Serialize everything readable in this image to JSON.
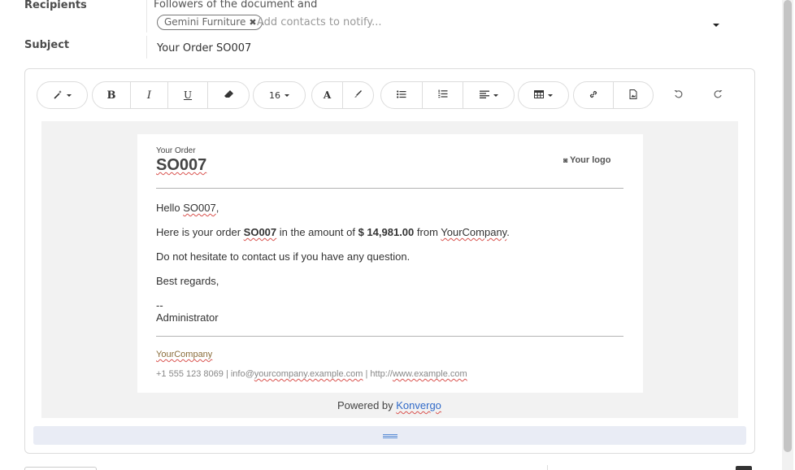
{
  "recipients": {
    "label": "Recipients",
    "followers_text": "Followers of the document and",
    "tag_label": "Gemini Furniture",
    "placeholder": "Add contacts to notify..."
  },
  "subject": {
    "label": "Subject",
    "value": "Your Order SO007"
  },
  "toolbar": {
    "font_size": "16",
    "icons": [
      "magic-wand-icon",
      "bold-icon",
      "italic-icon",
      "underline-icon",
      "eraser-icon",
      "font-color-icon",
      "highlight-icon",
      "bullet-list-icon",
      "numbered-list-icon",
      "align-icon",
      "table-icon",
      "link-icon",
      "media-icon",
      "undo-icon",
      "redo-icon"
    ]
  },
  "mail": {
    "header_small": "Your Order",
    "header_big": "SO007",
    "logo_text": "Your logo",
    "greeting_prefix": "Hello ",
    "greeting_name": "SO007",
    "greeting_suffix": ",",
    "line1_a": "Here is your order ",
    "line1_order": "SO007",
    "line1_b": " in the amount of ",
    "line1_amount": "$ 14,981.00",
    "line1_c": " from ",
    "line1_company": "YourCompany",
    "line1_d": ".",
    "line2": "Do not hesitate to contact us if you have any question.",
    "line3": "Best regards,",
    "sig_dash": "--",
    "sig_name": "Administrator",
    "footer_company": "YourCompany",
    "footer_phone": "+1 555 123 8069 | info@",
    "footer_domain": "yourcompany.example.com",
    "footer_mid": " | http://",
    "footer_web": "www.example.com"
  },
  "powered_by": {
    "text": "Powered by ",
    "link": "Konvergo"
  },
  "colors": {
    "link": "#2f69c8",
    "spell": "#d9534f",
    "canvas": "#f2f2f2",
    "resize": "#e9ecf5"
  }
}
